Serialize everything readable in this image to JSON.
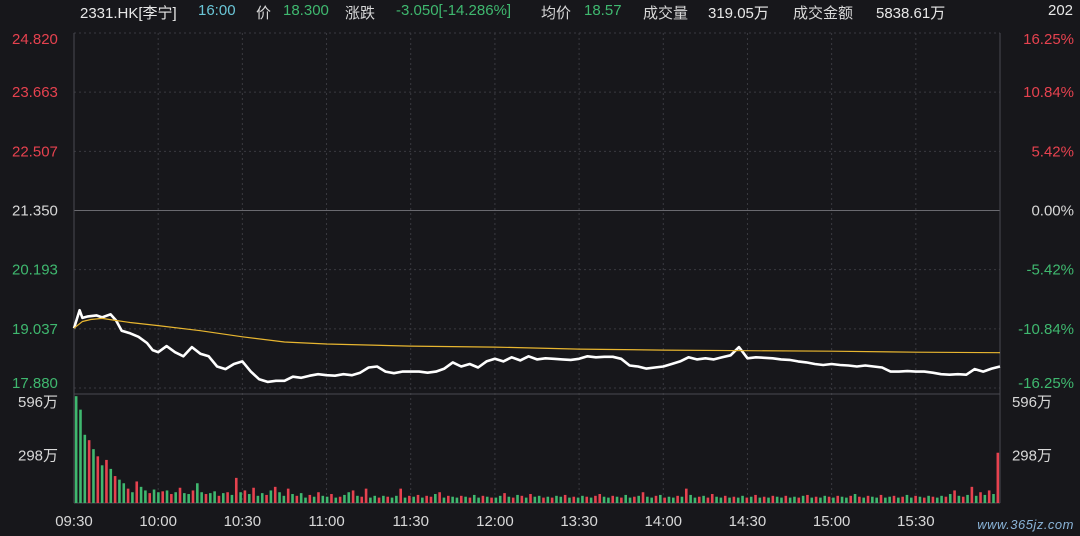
{
  "header": {
    "code": "2331.HK[李宁]",
    "time": "16:00",
    "price_label": "价",
    "price": "18.300",
    "change_label": "涨跌",
    "change": "-3.050[-14.286%]",
    "avg_label": "均价",
    "avg": "18.57",
    "volume_label": "成交量",
    "volume": "319.05万",
    "turnover_label": "成交金额",
    "turnover": "5838.61万",
    "right_label": "202"
  },
  "colors": {
    "background": "#17171b",
    "up": "#e6424f",
    "down": "#3fb86f",
    "neutral": "#d8d8d8",
    "price_line": "#ffffff",
    "avg_line": "#e8b630",
    "grid": "#3a3a40"
  },
  "watermark": "www.365jz.com",
  "chart_data": {
    "type": "line",
    "price_axis": {
      "ticks": [
        "24.820",
        "23.663",
        "22.507",
        "21.350",
        "20.193",
        "19.037",
        "17.880"
      ],
      "values": [
        24.82,
        23.663,
        22.507,
        21.35,
        20.193,
        19.037,
        17.88
      ],
      "pct_ticks": [
        "16.25%",
        "10.84%",
        "5.42%",
        "0.00%",
        "-5.42%",
        "-10.84%",
        "-16.25%"
      ],
      "prev_close": 21.35,
      "ylim": [
        17.88,
        24.82
      ]
    },
    "volume_axis": {
      "left_ticks": [
        "596万",
        "298万"
      ],
      "right_ticks": [
        "596万",
        "298万"
      ],
      "ylim": [
        0,
        596
      ]
    },
    "x_ticks": [
      "09:30",
      "10:00",
      "10:30",
      "11:00",
      "11:30",
      "12:00",
      "13:30",
      "14:00",
      "14:30",
      "15:00",
      "15:30"
    ],
    "series": [
      {
        "name": "价",
        "points": [
          [
            "09:30",
            19.05
          ],
          [
            "09:32",
            19.4
          ],
          [
            "09:33",
            19.25
          ],
          [
            "09:35",
            19.28
          ],
          [
            "09:38",
            19.3
          ],
          [
            "09:40",
            19.26
          ],
          [
            "09:43",
            19.32
          ],
          [
            "09:45",
            19.2
          ],
          [
            "09:47",
            19.0
          ],
          [
            "09:50",
            18.95
          ],
          [
            "09:53",
            18.88
          ],
          [
            "09:56",
            18.76
          ],
          [
            "09:58",
            18.62
          ],
          [
            "10:00",
            18.58
          ],
          [
            "10:03",
            18.7
          ],
          [
            "10:06",
            18.58
          ],
          [
            "10:09",
            18.5
          ],
          [
            "10:12",
            18.68
          ],
          [
            "10:15",
            18.55
          ],
          [
            "10:18",
            18.5
          ],
          [
            "10:21",
            18.3
          ],
          [
            "10:24",
            18.25
          ],
          [
            "10:27",
            18.35
          ],
          [
            "10:30",
            18.4
          ],
          [
            "10:33",
            18.2
          ],
          [
            "10:36",
            18.05
          ],
          [
            "10:39",
            18.0
          ],
          [
            "10:42",
            18.02
          ],
          [
            "10:45",
            18.02
          ],
          [
            "10:48",
            18.1
          ],
          [
            "10:51",
            18.08
          ],
          [
            "10:54",
            18.12
          ],
          [
            "10:57",
            18.15
          ],
          [
            "11:00",
            18.13
          ],
          [
            "11:03",
            18.12
          ],
          [
            "11:06",
            18.15
          ],
          [
            "11:09",
            18.13
          ],
          [
            "11:12",
            18.18
          ],
          [
            "11:15",
            18.28
          ],
          [
            "11:18",
            18.3
          ],
          [
            "11:21",
            18.2
          ],
          [
            "11:24",
            18.17
          ],
          [
            "11:27",
            18.2
          ],
          [
            "11:30",
            18.2
          ],
          [
            "11:33",
            18.2
          ],
          [
            "11:36",
            18.18
          ],
          [
            "11:39",
            18.2
          ],
          [
            "11:42",
            18.26
          ],
          [
            "11:45",
            18.38
          ],
          [
            "11:48",
            18.3
          ],
          [
            "11:51",
            18.35
          ],
          [
            "11:54",
            18.28
          ],
          [
            "11:57",
            18.4
          ],
          [
            "12:00",
            18.45
          ],
          [
            "13:03",
            18.4
          ],
          [
            "13:06",
            18.48
          ],
          [
            "13:09",
            18.42
          ],
          [
            "13:12",
            18.5
          ],
          [
            "13:15",
            18.44
          ],
          [
            "13:18",
            18.46
          ],
          [
            "13:21",
            18.45
          ],
          [
            "13:24",
            18.44
          ],
          [
            "13:27",
            18.43
          ],
          [
            "13:30",
            18.45
          ],
          [
            "13:33",
            18.5
          ],
          [
            "13:36",
            18.48
          ],
          [
            "13:39",
            18.49
          ],
          [
            "13:42",
            18.49
          ],
          [
            "13:45",
            18.45
          ],
          [
            "13:48",
            18.32
          ],
          [
            "13:51",
            18.3
          ],
          [
            "13:54",
            18.26
          ],
          [
            "13:57",
            18.28
          ],
          [
            "14:00",
            18.3
          ],
          [
            "14:03",
            18.35
          ],
          [
            "14:06",
            18.4
          ],
          [
            "14:09",
            18.48
          ],
          [
            "14:12",
            18.44
          ],
          [
            "14:15",
            18.46
          ],
          [
            "14:18",
            18.44
          ],
          [
            "14:21",
            18.48
          ],
          [
            "14:24",
            18.52
          ],
          [
            "14:27",
            18.68
          ],
          [
            "14:30",
            18.46
          ],
          [
            "14:33",
            18.48
          ],
          [
            "14:36",
            18.47
          ],
          [
            "14:39",
            18.46
          ],
          [
            "14:42",
            18.44
          ],
          [
            "14:45",
            18.43
          ],
          [
            "14:48",
            18.4
          ],
          [
            "14:51",
            18.38
          ],
          [
            "14:54",
            18.35
          ],
          [
            "14:57",
            18.33
          ],
          [
            "15:00",
            18.35
          ],
          [
            "15:03",
            18.33
          ],
          [
            "15:06",
            18.32
          ],
          [
            "15:09",
            18.3
          ],
          [
            "15:12",
            18.32
          ],
          [
            "15:15",
            18.3
          ],
          [
            "15:18",
            18.28
          ],
          [
            "15:21",
            18.2
          ],
          [
            "15:24",
            18.2
          ],
          [
            "15:27",
            18.21
          ],
          [
            "15:30",
            18.2
          ],
          [
            "15:33",
            18.2
          ],
          [
            "15:36",
            18.18
          ],
          [
            "15:39",
            18.15
          ],
          [
            "15:42",
            18.14
          ],
          [
            "15:45",
            18.15
          ],
          [
            "15:48",
            18.14
          ],
          [
            "15:51",
            18.25
          ],
          [
            "15:54",
            18.2
          ],
          [
            "15:57",
            18.26
          ],
          [
            "16:00",
            18.3
          ]
        ]
      },
      {
        "name": "均价",
        "points": [
          [
            "09:30",
            19.05
          ],
          [
            "09:33",
            19.18
          ],
          [
            "09:36",
            19.22
          ],
          [
            "09:40",
            19.24
          ],
          [
            "09:45",
            19.2
          ],
          [
            "09:50",
            19.16
          ],
          [
            "10:00",
            19.1
          ],
          [
            "10:15",
            19.0
          ],
          [
            "10:30",
            18.88
          ],
          [
            "10:45",
            18.78
          ],
          [
            "11:00",
            18.74
          ],
          [
            "11:30",
            18.7
          ],
          [
            "12:00",
            18.68
          ],
          [
            "13:30",
            18.64
          ],
          [
            "14:00",
            18.62
          ],
          [
            "14:30",
            18.61
          ],
          [
            "15:00",
            18.6
          ],
          [
            "15:30",
            18.58
          ],
          [
            "16:00",
            18.57
          ]
        ]
      }
    ],
    "volume_bars": [
      [
        595,
        0
      ],
      [
        520,
        0
      ],
      [
        380,
        0
      ],
      [
        350,
        1
      ],
      [
        300,
        0
      ],
      [
        260,
        1
      ],
      [
        210,
        0
      ],
      [
        240,
        1
      ],
      [
        190,
        0
      ],
      [
        150,
        1
      ],
      [
        130,
        0
      ],
      [
        110,
        0
      ],
      [
        80,
        1
      ],
      [
        60,
        0
      ],
      [
        120,
        1
      ],
      [
        90,
        0
      ],
      [
        70,
        0
      ],
      [
        55,
        1
      ],
      [
        75,
        0
      ],
      [
        60,
        0
      ],
      [
        65,
        1
      ],
      [
        70,
        0
      ],
      [
        50,
        1
      ],
      [
        60,
        0
      ],
      [
        85,
        1
      ],
      [
        55,
        0
      ],
      [
        50,
        0
      ],
      [
        70,
        1
      ],
      [
        110,
        0
      ],
      [
        60,
        0
      ],
      [
        50,
        1
      ],
      [
        55,
        0
      ],
      [
        65,
        0
      ],
      [
        40,
        1
      ],
      [
        55,
        0
      ],
      [
        60,
        1
      ],
      [
        45,
        0
      ],
      [
        140,
        1
      ],
      [
        60,
        0
      ],
      [
        70,
        1
      ],
      [
        50,
        0
      ],
      [
        85,
        1
      ],
      [
        40,
        0
      ],
      [
        55,
        0
      ],
      [
        45,
        1
      ],
      [
        70,
        0
      ],
      [
        90,
        1
      ],
      [
        60,
        0
      ],
      [
        40,
        0
      ],
      [
        80,
        1
      ],
      [
        50,
        0
      ],
      [
        40,
        1
      ],
      [
        55,
        0
      ],
      [
        30,
        0
      ],
      [
        45,
        1
      ],
      [
        35,
        0
      ],
      [
        60,
        1
      ],
      [
        40,
        0
      ],
      [
        35,
        0
      ],
      [
        50,
        1
      ],
      [
        30,
        0
      ],
      [
        35,
        1
      ],
      [
        45,
        0
      ],
      [
        60,
        0
      ],
      [
        70,
        1
      ],
      [
        40,
        0
      ],
      [
        35,
        1
      ],
      [
        80,
        1
      ],
      [
        30,
        0
      ],
      [
        40,
        0
      ],
      [
        30,
        1
      ],
      [
        40,
        0
      ],
      [
        35,
        1
      ],
      [
        30,
        0
      ],
      [
        40,
        0
      ],
      [
        80,
        1
      ],
      [
        30,
        0
      ],
      [
        40,
        1
      ],
      [
        35,
        0
      ],
      [
        45,
        1
      ],
      [
        30,
        0
      ],
      [
        40,
        1
      ],
      [
        35,
        1
      ],
      [
        50,
        0
      ],
      [
        60,
        1
      ],
      [
        30,
        0
      ],
      [
        40,
        1
      ],
      [
        35,
        0
      ],
      [
        30,
        0
      ],
      [
        40,
        1
      ],
      [
        35,
        0
      ],
      [
        30,
        1
      ],
      [
        45,
        0
      ],
      [
        30,
        0
      ],
      [
        40,
        1
      ],
      [
        35,
        0
      ],
      [
        30,
        1
      ],
      [
        30,
        0
      ],
      [
        40,
        0
      ],
      [
        55,
        1
      ],
      [
        35,
        0
      ],
      [
        30,
        1
      ],
      [
        45,
        0
      ],
      [
        40,
        1
      ],
      [
        30,
        0
      ],
      [
        50,
        1
      ],
      [
        35,
        0
      ],
      [
        40,
        0
      ],
      [
        30,
        1
      ],
      [
        35,
        0
      ],
      [
        30,
        1
      ],
      [
        40,
        0
      ],
      [
        35,
        0
      ],
      [
        45,
        1
      ],
      [
        30,
        0
      ],
      [
        35,
        1
      ],
      [
        30,
        0
      ],
      [
        40,
        0
      ],
      [
        35,
        1
      ],
      [
        30,
        0
      ],
      [
        40,
        1
      ],
      [
        50,
        1
      ],
      [
        35,
        0
      ],
      [
        30,
        0
      ],
      [
        40,
        1
      ],
      [
        35,
        0
      ],
      [
        30,
        1
      ],
      [
        45,
        0
      ],
      [
        30,
        0
      ],
      [
        35,
        1
      ],
      [
        40,
        0
      ],
      [
        60,
        1
      ],
      [
        35,
        0
      ],
      [
        30,
        0
      ],
      [
        40,
        1
      ],
      [
        45,
        0
      ],
      [
        30,
        1
      ],
      [
        35,
        0
      ],
      [
        30,
        0
      ],
      [
        40,
        1
      ],
      [
        35,
        0
      ],
      [
        80,
        1
      ],
      [
        45,
        0
      ],
      [
        30,
        0
      ],
      [
        35,
        1
      ],
      [
        40,
        0
      ],
      [
        30,
        1
      ],
      [
        50,
        1
      ],
      [
        35,
        0
      ],
      [
        30,
        0
      ],
      [
        40,
        1
      ],
      [
        30,
        0
      ],
      [
        35,
        1
      ],
      [
        30,
        0
      ],
      [
        40,
        0
      ],
      [
        30,
        1
      ],
      [
        35,
        0
      ],
      [
        45,
        1
      ],
      [
        30,
        0
      ],
      [
        35,
        1
      ],
      [
        30,
        0
      ],
      [
        40,
        1
      ],
      [
        35,
        0
      ],
      [
        30,
        0
      ],
      [
        40,
        1
      ],
      [
        30,
        0
      ],
      [
        35,
        0
      ],
      [
        30,
        1
      ],
      [
        40,
        0
      ],
      [
        45,
        1
      ],
      [
        30,
        0
      ],
      [
        35,
        1
      ],
      [
        30,
        0
      ],
      [
        40,
        0
      ],
      [
        35,
        1
      ],
      [
        30,
        0
      ],
      [
        40,
        1
      ],
      [
        35,
        0
      ],
      [
        30,
        0
      ],
      [
        40,
        1
      ],
      [
        50,
        0
      ],
      [
        35,
        1
      ],
      [
        30,
        0
      ],
      [
        40,
        1
      ],
      [
        35,
        0
      ],
      [
        30,
        0
      ],
      [
        45,
        1
      ],
      [
        30,
        0
      ],
      [
        35,
        0
      ],
      [
        40,
        1
      ],
      [
        30,
        0
      ],
      [
        35,
        1
      ],
      [
        45,
        0
      ],
      [
        30,
        0
      ],
      [
        40,
        1
      ],
      [
        35,
        0
      ],
      [
        30,
        1
      ],
      [
        40,
        0
      ],
      [
        35,
        1
      ],
      [
        30,
        0
      ],
      [
        40,
        0
      ],
      [
        35,
        1
      ],
      [
        50,
        0
      ],
      [
        70,
        1
      ],
      [
        40,
        0
      ],
      [
        35,
        1
      ],
      [
        45,
        0
      ],
      [
        90,
        1
      ],
      [
        40,
        0
      ],
      [
        60,
        1
      ],
      [
        45,
        0
      ],
      [
        70,
        1
      ],
      [
        50,
        0
      ],
      [
        280,
        1
      ]
    ]
  }
}
